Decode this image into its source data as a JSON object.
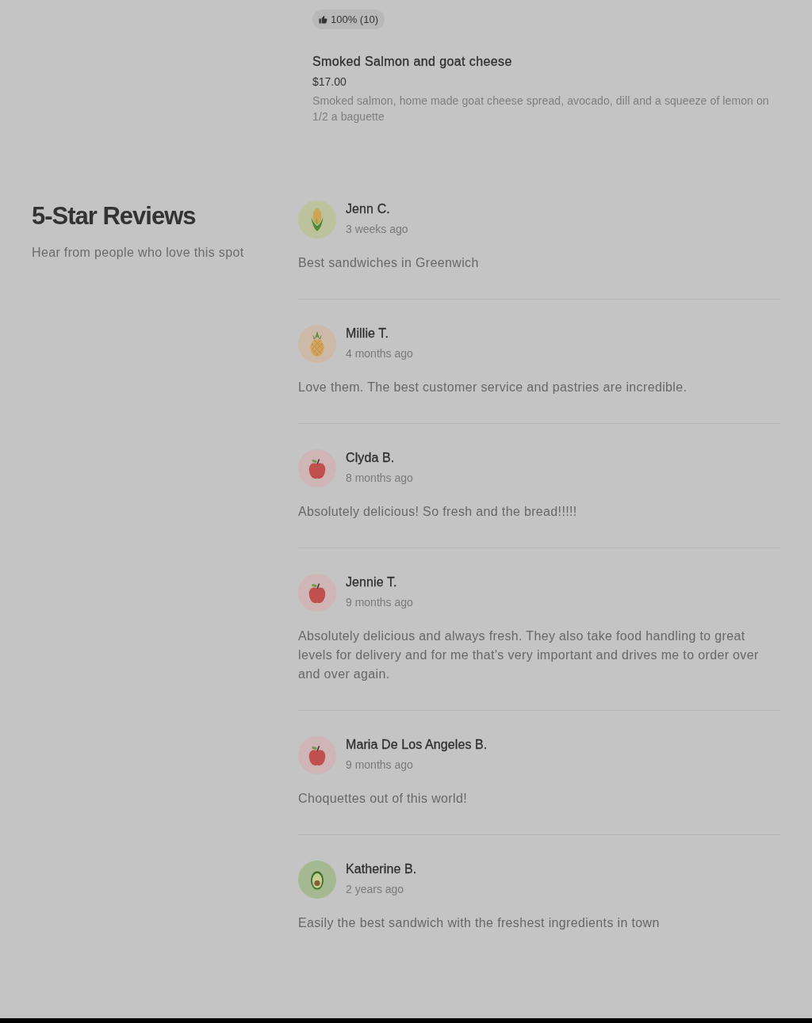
{
  "menu_items": [
    {
      "rating": "100% (10)"
    },
    {
      "name": "Smoked Salmon and goat cheese",
      "price": "$17.00",
      "description": "Smoked salmon, home made goat cheese spread, avocado, dill and a squeeze of lemon on 1/2 a baguette"
    }
  ],
  "reviews_section": {
    "title": "5-Star Reviews",
    "subtitle": "Hear from people who love this spot",
    "reviews": [
      {
        "kind": "corn",
        "name": "Jenn C.",
        "time": "3 weeks ago",
        "text": "Best sandwiches in Greenwich"
      },
      {
        "kind": "pineapple",
        "name": "Millie T.",
        "time": "4 months ago",
        "text": "Love them. The best customer service and pastries are incredible."
      },
      {
        "kind": "apple",
        "name": "Clyda B.",
        "time": "8 months ago",
        "text": "Absolutely delicious! So fresh and the bread!!!!!"
      },
      {
        "kind": "apple",
        "name": "Jennie T.",
        "time": "9 months ago",
        "text": "Absolutely delicious and always fresh. They also take food handling to great levels for delivery and for me that's very important and drives me to order over and over again."
      },
      {
        "kind": "apple",
        "name": "Maria De Los Angeles B.",
        "time": "9 months ago",
        "text": "Choquettes out of this world!"
      },
      {
        "kind": "avocado",
        "name": "Katherine B.",
        "time": "2 years ago",
        "text": "Easily the best sandwich with the freshest ingredients in town"
      }
    ]
  }
}
